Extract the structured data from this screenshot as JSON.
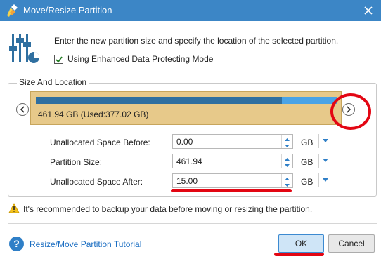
{
  "window": {
    "title": "Move/Resize Partition",
    "close_icon": "close-icon"
  },
  "header": {
    "instruction": "Enter the new partition size and specify the location of the selected partition.",
    "enhanced_mode_label": "Using Enhanced Data Protecting Mode",
    "enhanced_mode_checked": true
  },
  "group": {
    "title": "Size And Location",
    "partition_label": "461.94 GB (Used:377.02 GB)",
    "used_fraction": 0.816,
    "colors": {
      "partition_bg": "#e7c98a",
      "used": "#2f6fa0",
      "free": "#4aa3e6",
      "annotation_red": "#e30613"
    }
  },
  "fields": [
    {
      "label": "Unallocated Space Before:",
      "value": "0.00",
      "unit": "GB"
    },
    {
      "label": "Partition Size:",
      "value": "461.94",
      "unit": "GB"
    },
    {
      "label": "Unallocated Space After:",
      "value": "15.00",
      "unit": "GB"
    }
  ],
  "warning": "It's recommended to backup your data before moving or resizing the partition.",
  "footer": {
    "tutorial_link": "Resize/Move Partition Tutorial",
    "ok_label": "OK",
    "cancel_label": "Cancel"
  }
}
